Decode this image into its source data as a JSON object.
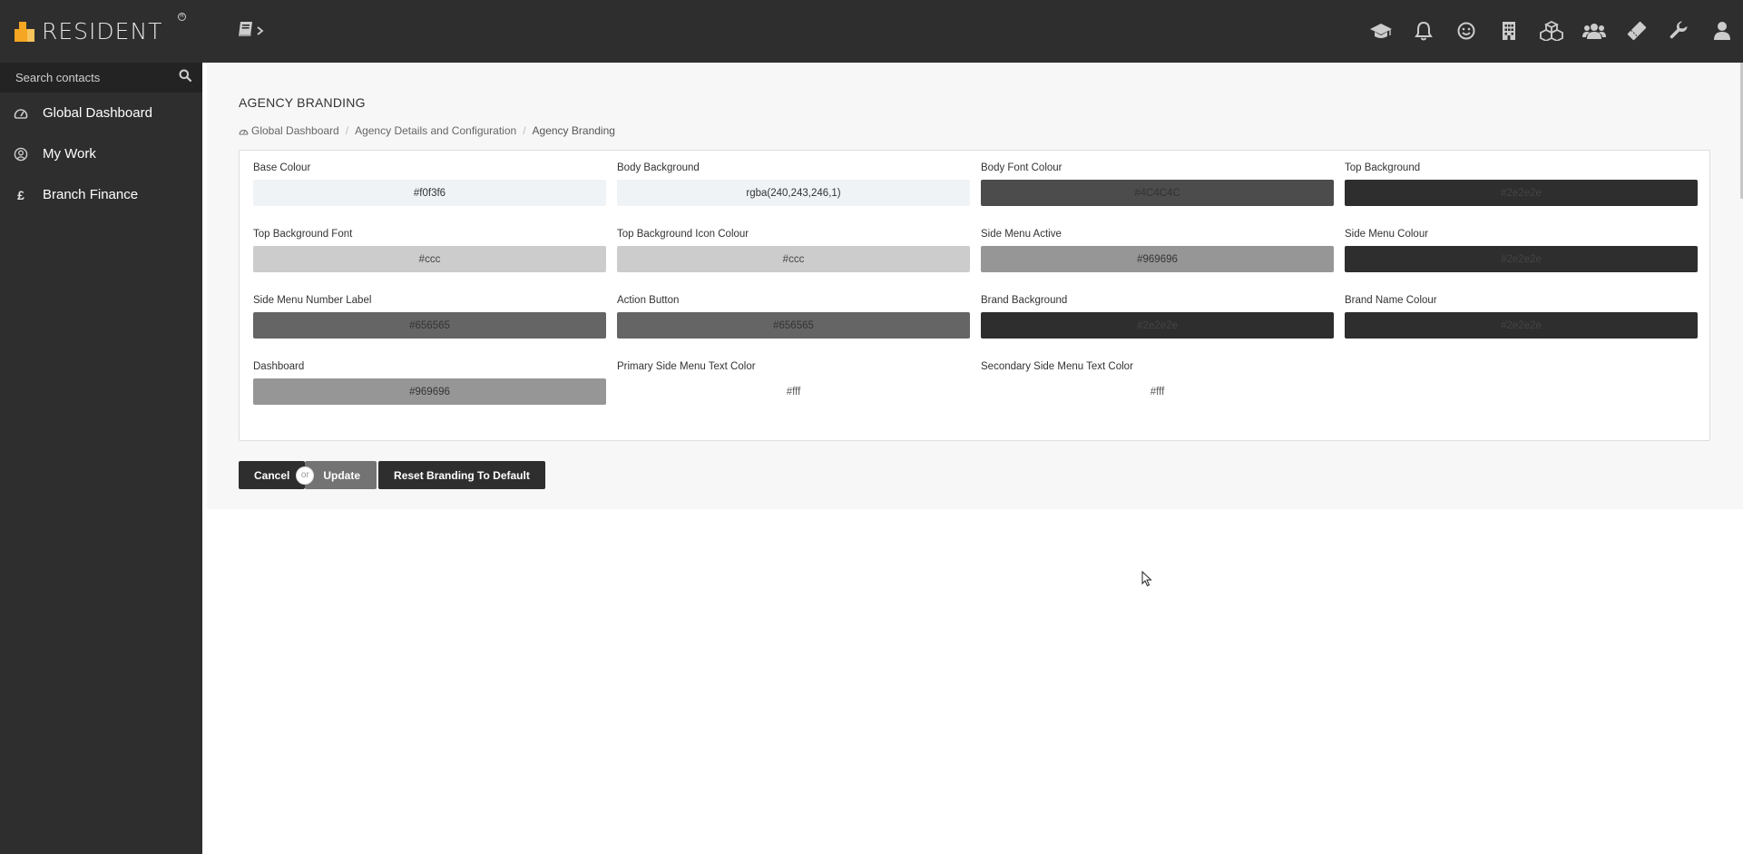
{
  "app": {
    "brand": "RESIDENT",
    "reg_mark": "R"
  },
  "search": {
    "placeholder": "Search contacts"
  },
  "sidebar": {
    "items": [
      {
        "label": "Global Dashboard",
        "icon": "dashboard-icon"
      },
      {
        "label": "My Work",
        "icon": "user-circle-icon"
      },
      {
        "label": "Branch Finance",
        "icon": "pound-icon"
      }
    ]
  },
  "topbar": {
    "icons": [
      "graduation-cap-icon",
      "bell-icon",
      "smile-icon",
      "building-icon",
      "cubes-icon",
      "users-icon",
      "ticket-icon",
      "wrench-icon",
      "user-icon"
    ]
  },
  "page": {
    "title": "AGENCY BRANDING",
    "breadcrumb": [
      "Global Dashboard",
      "Agency Details and Configuration",
      "Agency Branding"
    ]
  },
  "fields": [
    {
      "label": "Base Colour",
      "value": "#f0f3f6",
      "bg": "#f0f3f6",
      "fg": "#333333"
    },
    {
      "label": "Body Background",
      "value": "rgba(240,243,246,1)",
      "bg": "#f0f3f6",
      "fg": "#333333"
    },
    {
      "label": "Body Font Colour",
      "value": "#4C4C4C",
      "bg": "#4c4c4c",
      "fg": "#333333"
    },
    {
      "label": "Top Background",
      "value": "#2e2e2e",
      "bg": "#2e2e2e",
      "fg": "#444444"
    },
    {
      "label": "Top Background Font",
      "value": "#ccc",
      "bg": "#cccccc",
      "fg": "#444444"
    },
    {
      "label": "Top Background Icon Colour",
      "value": "#ccc",
      "bg": "#cccccc",
      "fg": "#444444"
    },
    {
      "label": "Side Menu Active",
      "value": "#969696",
      "bg": "#969696",
      "fg": "#333333"
    },
    {
      "label": "Side Menu Colour",
      "value": "#2e2e2e",
      "bg": "#2e2e2e",
      "fg": "#444444"
    },
    {
      "label": "Side Menu Number Label",
      "value": "#656565",
      "bg": "#656565",
      "fg": "#333333"
    },
    {
      "label": "Action Button",
      "value": "#656565",
      "bg": "#656565",
      "fg": "#333333"
    },
    {
      "label": "Brand Background",
      "value": "#2e2e2e",
      "bg": "#2e2e2e",
      "fg": "#444444"
    },
    {
      "label": "Brand Name Colour",
      "value": "#2e2e2e",
      "bg": "#2e2e2e",
      "fg": "#444444"
    },
    {
      "label": "Dashboard",
      "value": "#969696",
      "bg": "#969696",
      "fg": "#333333"
    },
    {
      "label": "Primary Side Menu Text Color",
      "value": "#fff",
      "bg": "#ffffff",
      "fg": "#555555"
    },
    {
      "label": "Secondary Side Menu Text Color",
      "value": "#fff",
      "bg": "#ffffff",
      "fg": "#555555"
    }
  ],
  "actions": {
    "cancel": "Cancel",
    "or": "or",
    "update": "Update",
    "reset": "Reset Branding To Default"
  },
  "colors": {
    "sidebar": "#2e2e2e",
    "topbar": "#2e2e2e",
    "accent": "#f5a623",
    "content_bg": "#f7f7f7"
  }
}
